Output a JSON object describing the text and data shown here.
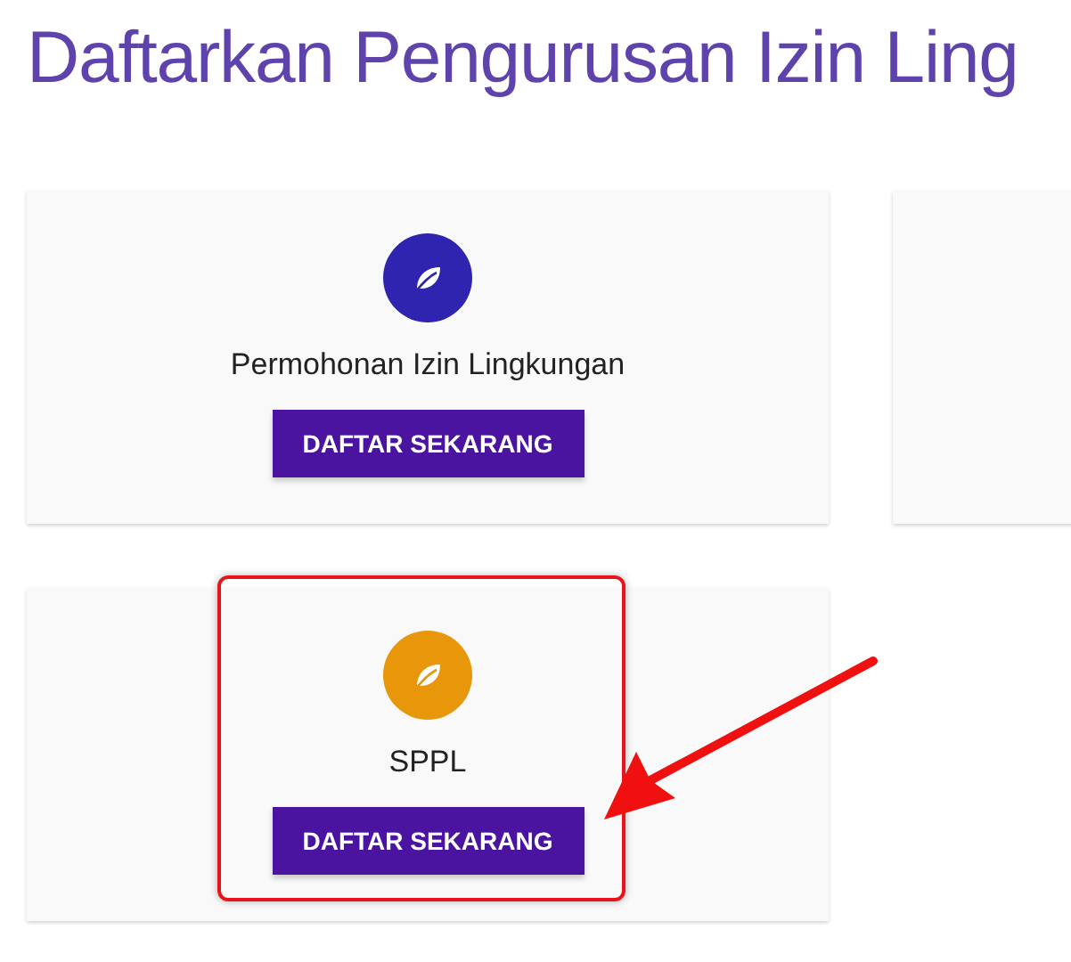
{
  "page_title": "Daftarkan Pengurusan Izin Ling",
  "cards": [
    {
      "kind": "service",
      "color": "#2e24b0",
      "label": "Permohonan Izin Lingkungan",
      "button": "DAFTAR SEKARANG"
    },
    {
      "kind": "blank"
    },
    {
      "kind": "service",
      "color": "#e8960a",
      "label": "SPPL",
      "button": "DAFTAR SEKARANG"
    }
  ],
  "annotations": [
    {
      "kind": "highlight-box"
    },
    {
      "kind": "arrow"
    }
  ]
}
